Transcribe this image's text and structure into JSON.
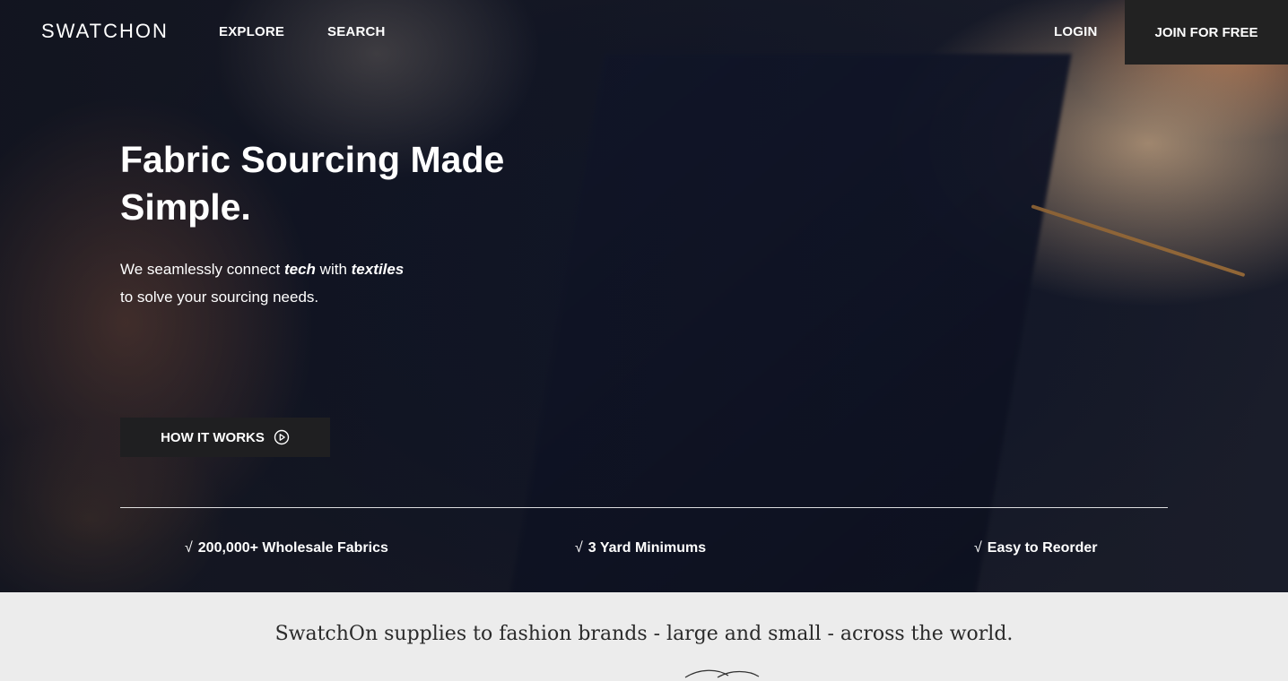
{
  "header": {
    "logo": "SWATCHON",
    "nav": {
      "explore": "EXPLORE",
      "search": "SEARCH"
    },
    "login": "LOGIN",
    "join": "JOIN FOR FREE"
  },
  "hero": {
    "headline": "Fabric Sourcing Made Simple.",
    "sub_line1_pre": "We seamlessly connect ",
    "sub_line1_em1": "tech",
    "sub_line1_mid": " with ",
    "sub_line1_em2": "textiles",
    "sub_line2": "to solve your sourcing needs.",
    "cta": "HOW IT WORKS"
  },
  "features": [
    {
      "check": "√",
      "label": "200,000+ Wholesale Fabrics"
    },
    {
      "check": "√",
      "label": "3 Yard Minimums"
    },
    {
      "check": "√",
      "label": "Easy to Reorder"
    }
  ],
  "supplies_text": "SwatchOn supplies to fashion brands - large and small - across the world.",
  "icons": {
    "cta_icon": "play-circle-icon"
  },
  "colors": {
    "join_bg": "#222222",
    "cta_bg": "#1f1f21",
    "section_bg": "#ececec"
  }
}
